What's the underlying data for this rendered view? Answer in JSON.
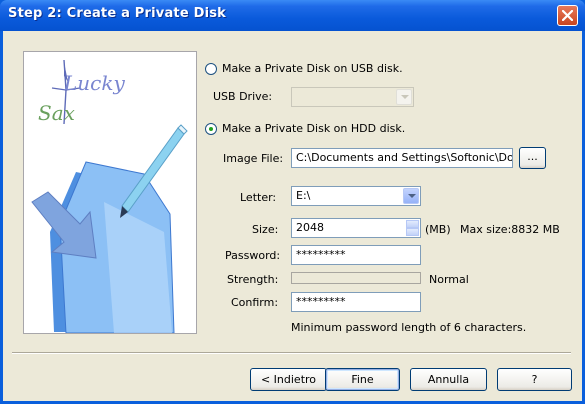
{
  "window": {
    "title": "Step 2: Create a Private Disk"
  },
  "logo": {
    "line1": "Lucky",
    "line2": "Sax"
  },
  "usb_option": {
    "label": "Make a Private Disk on USB disk.",
    "selected": false,
    "drive_label": "USB Drive:",
    "drive_value": ""
  },
  "hdd_option": {
    "label": "Make a Private Disk on HDD disk.",
    "selected": true
  },
  "form": {
    "image_file_label": "Image File:",
    "image_file_value": "C:\\Documents and Settings\\Softonic\\Docum",
    "browse_label": "...",
    "letter_label": "Letter:",
    "letter_value": "E:\\",
    "size_label": "Size:",
    "size_value": "2048",
    "size_unit": "(MB)",
    "max_size": "Max size:8832 MB",
    "password_label": "Password:",
    "password_value": "*********",
    "strength_label": "Strength:",
    "strength_value": "Normal",
    "confirm_label": "Confirm:",
    "confirm_value": "*********",
    "hint": "Minimum password length of 6 characters."
  },
  "buttons": {
    "back": "< Indietro",
    "finish": "Fine",
    "cancel": "Annulla",
    "help": "?"
  },
  "colors": {
    "title_bar": "#0A5ADB",
    "close_button": "#D4512C",
    "dialog_bg": "#ECE9D8",
    "radio_dot": "#21A121"
  },
  "icons": [
    "close-icon",
    "lucky-sax-logo",
    "pen-icon",
    "folder-icon",
    "arrow-icon",
    "dropdown-arrow-icon"
  ]
}
